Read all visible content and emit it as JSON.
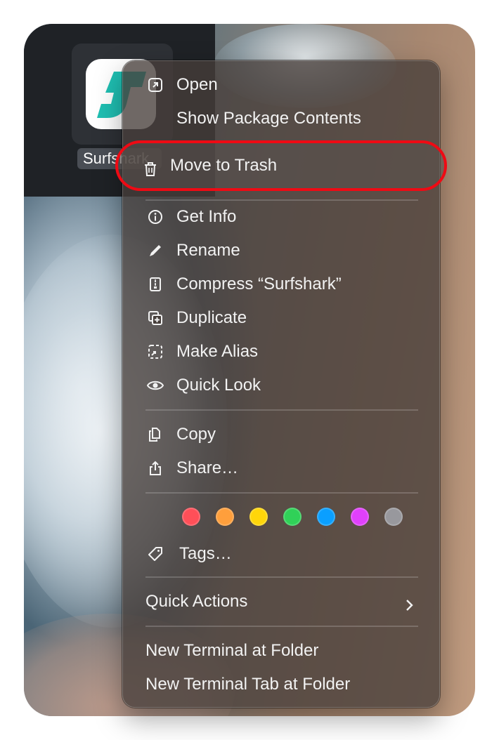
{
  "app_label": "Surfshark",
  "menu": {
    "items_top": [
      {
        "label": "Open",
        "icon": "open-external-icon"
      },
      {
        "label": "Show Package Contents",
        "icon": ""
      }
    ],
    "highlighted": {
      "label": "Move to Trash",
      "icon": "trash-icon",
      "highlight_color": "#ef0a14"
    },
    "items_mid": [
      {
        "label": "Get Info",
        "icon": "info-icon"
      },
      {
        "label": "Rename",
        "icon": "pencil-icon"
      },
      {
        "label": "Compress “Surfshark”",
        "icon": "archive-icon"
      },
      {
        "label": "Duplicate",
        "icon": "duplicate-icon"
      },
      {
        "label": "Make Alias",
        "icon": "alias-icon"
      },
      {
        "label": "Quick Look",
        "icon": "eye-icon"
      }
    ],
    "items_share": [
      {
        "label": "Copy",
        "icon": "copy-icon"
      },
      {
        "label": "Share…",
        "icon": "share-icon"
      }
    ],
    "tag_colors": [
      "#ff4f58",
      "#ff9f3c",
      "#ffd60a",
      "#30d158",
      "#0a9fff",
      "#e040fb",
      "#98989d"
    ],
    "tags_label": "Tags…",
    "quick_actions": "Quick Actions",
    "terminal_items": [
      "New Terminal at Folder",
      "New Terminal Tab at Folder"
    ]
  }
}
